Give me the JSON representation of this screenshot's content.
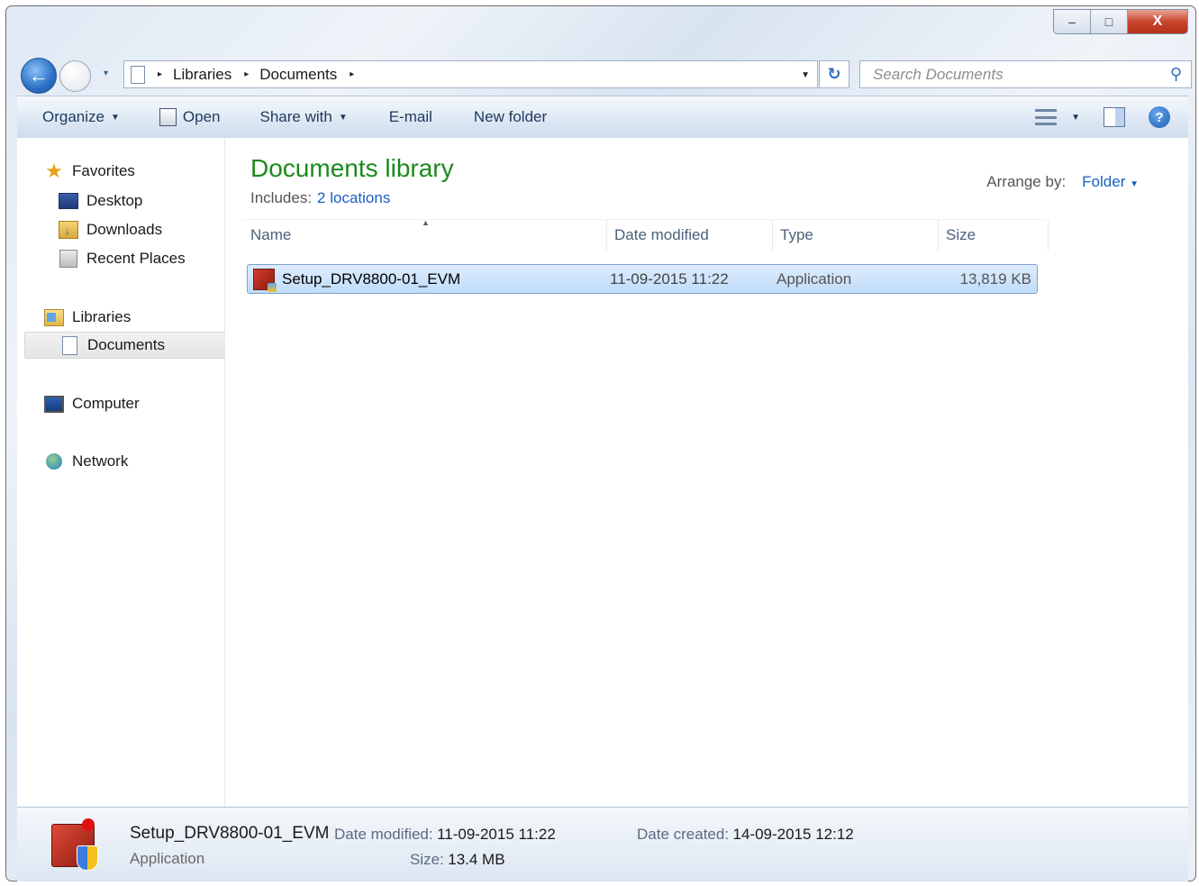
{
  "window": {
    "caption_buttons": {
      "minimize": "–",
      "maximize": "□",
      "close": "X"
    }
  },
  "nav": {
    "back_icon": "back-arrow-icon",
    "forward_icon": "forward-arrow-icon",
    "recent_caret": "▾",
    "address": {
      "crumbs": [
        "Libraries",
        "Documents"
      ],
      "separator": "▸"
    },
    "refresh_glyph": "↻",
    "search": {
      "placeholder": "Search Documents"
    }
  },
  "toolbar": {
    "organize": "Organize",
    "open": "Open",
    "share_with": "Share with",
    "email": "E-mail",
    "new_folder": "New folder"
  },
  "sidebar": {
    "favorites": "Favorites",
    "desktop": "Desktop",
    "downloads": "Downloads",
    "recent_places": "Recent Places",
    "libraries": "Libraries",
    "documents": "Documents",
    "computer": "Computer",
    "network": "Network"
  },
  "content": {
    "title": "Documents library",
    "includes_label": "Includes:",
    "includes_link": "2 locations",
    "arrange_label": "Arrange by:",
    "arrange_value": "Folder",
    "columns": {
      "name": "Name",
      "date": "Date modified",
      "type": "Type",
      "size": "Size"
    },
    "files": [
      {
        "name": "Setup_DRV8800-01_EVM",
        "date": "11-09-2015 11:22",
        "type": "Application",
        "size": "13,819 KB"
      }
    ]
  },
  "details": {
    "name": "Setup_DRV8800-01_EVM",
    "type": "Application",
    "date_modified_label": "Date modified:",
    "date_modified": "11-09-2015 11:22",
    "size_label": "Size:",
    "size": "13.4 MB",
    "date_created_label": "Date created:",
    "date_created": "14-09-2015 12:12"
  },
  "colors": {
    "accent_green": "#1c8a1c",
    "link_blue": "#1c5fc0",
    "selection": "#c1dcfa"
  }
}
